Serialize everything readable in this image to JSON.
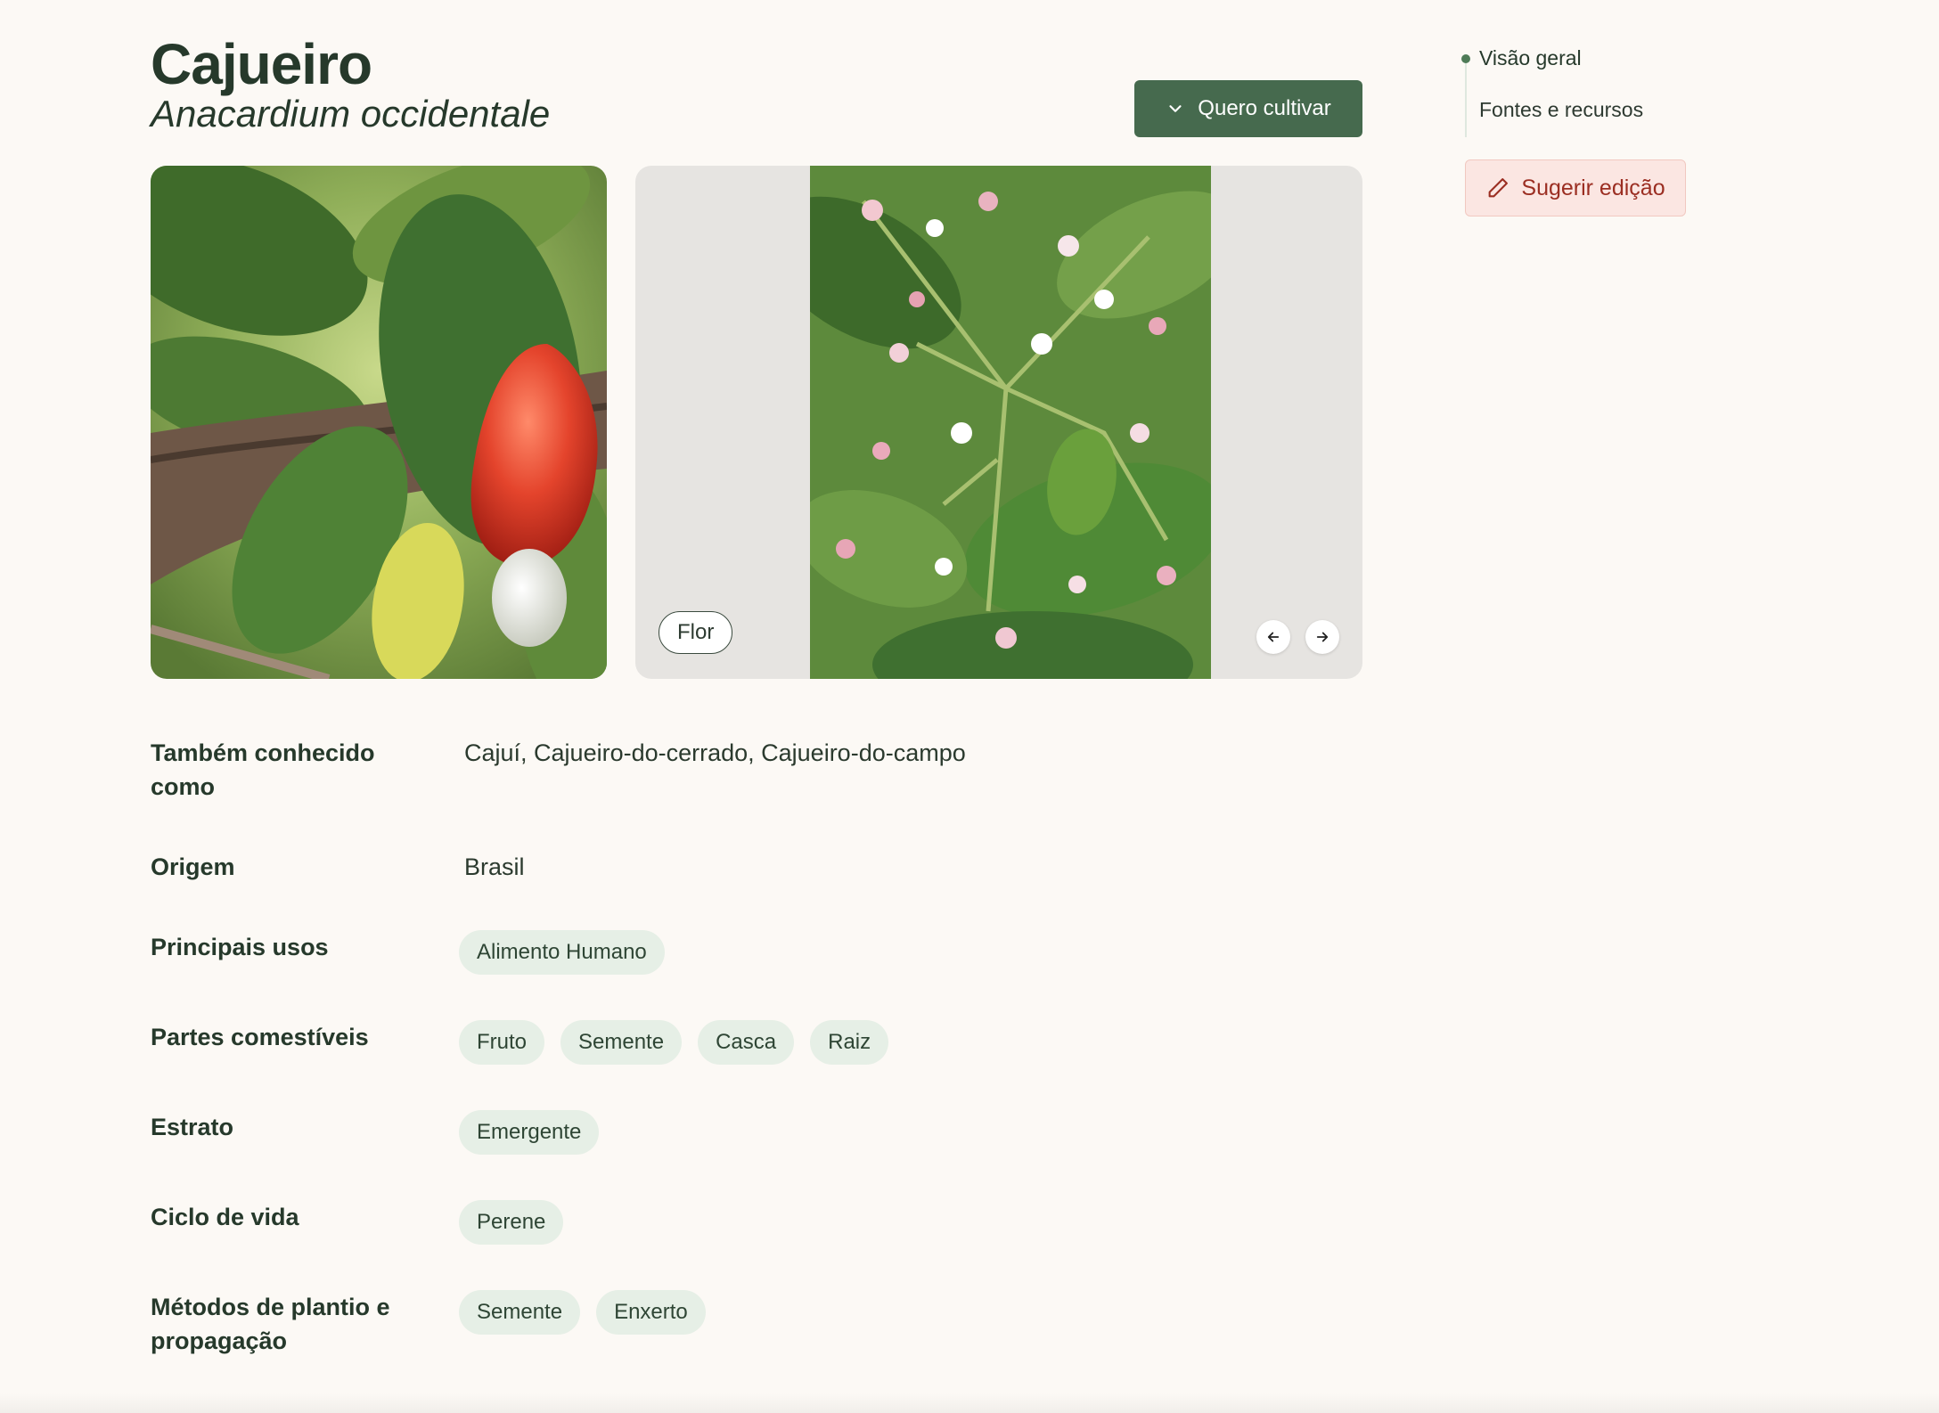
{
  "plant": {
    "common_name": "Cajueiro",
    "scientific_name": "Anacardium occidentale"
  },
  "actions": {
    "cultivar_label": "Quero cultivar",
    "suggest_edit_label": "Sugerir edição"
  },
  "gallery": {
    "current_tag": "Flor"
  },
  "toc": {
    "items": [
      "Visão geral",
      "Fontes e recursos"
    ]
  },
  "details": {
    "aka": {
      "label": "Também conhecido como",
      "value": "Cajuí, Cajueiro-do-cerrado, Cajueiro-do-campo"
    },
    "origin": {
      "label": "Origem",
      "value": "Brasil"
    },
    "uses": {
      "label": "Principais usos",
      "values": [
        "Alimento Humano"
      ]
    },
    "edible_parts": {
      "label": "Partes comestíveis",
      "values": [
        "Fruto",
        "Semente",
        "Casca",
        "Raiz"
      ]
    },
    "stratum": {
      "label": "Estrato",
      "values": [
        "Emergente"
      ]
    },
    "life_cycle": {
      "label": "Ciclo de vida",
      "values": [
        "Perene"
      ]
    },
    "propagation": {
      "label": "Métodos de plantio e propagação",
      "values": [
        "Semente",
        "Enxerto"
      ]
    }
  },
  "colors": {
    "primary_green": "#466a4e",
    "chip_bg": "#e6efe6",
    "suggest_bg": "#fbe6e2",
    "suggest_text": "#9b2e22",
    "page_bg": "#fcf9f5"
  }
}
